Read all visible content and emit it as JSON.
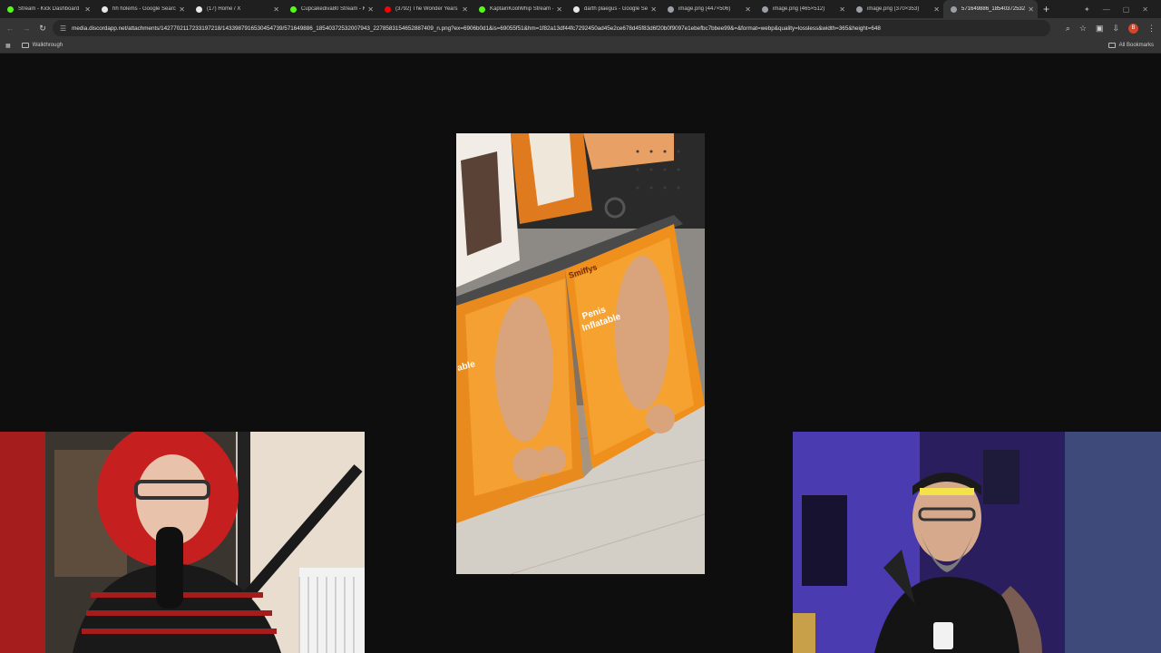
{
  "browser": {
    "tabs": [
      {
        "title": "Stream - Kick Dashboard",
        "favicon_color": "#53fc18",
        "active": false
      },
      {
        "title": "hh holems - Google Search",
        "favicon_color": "#e8e8e8",
        "active": false
      },
      {
        "title": "(17) Home / X",
        "favicon_color": "#e8e8e8",
        "active": false
      },
      {
        "title": "Cupcakediva80 Stream - Kick",
        "favicon_color": "#53fc18",
        "active": false
      },
      {
        "title": "(3792) The Wonder Years",
        "favicon_color": "#ff0000",
        "active": false
      },
      {
        "title": "KaptainKoolWhip Stream - Kick",
        "favicon_color": "#53fc18",
        "active": false
      },
      {
        "title": "darth plaegus - Google Search",
        "favicon_color": "#e8e8e8",
        "active": false
      },
      {
        "title": "image.png (447×506)",
        "favicon_color": "#9aa0a6",
        "active": false
      },
      {
        "title": "image.png (465×512)",
        "favicon_color": "#9aa0a6",
        "active": false
      },
      {
        "title": "image.png (370×353)",
        "favicon_color": "#9aa0a6",
        "active": false
      },
      {
        "title": "571649886_18540372532",
        "favicon_color": "#9aa0a6",
        "active": true
      }
    ],
    "new_tab_label": "+",
    "url": "media.discordapp.net/attachments/1427702117233197218/1433987916530454739/571649886_18540372532007943_2278583154652887409_n.png?ex=6906b0d1&is=69055f51&hm=1f82a13df44fc7292450ad45e2ce678d45f83d6f20b0f9097e1ebefbc7bbee99&=&format=webp&quality=lossless&width=365&height=648",
    "bookmarks": [
      {
        "label": "Walkthrough"
      }
    ],
    "all_bookmarks_label": "All Bookmarks",
    "profile_initial": "B"
  },
  "photo_text": {
    "package_brand": "Smiffys",
    "package_line1": "Penis",
    "package_line2": "Inflatable",
    "left_fragment": "able"
  }
}
